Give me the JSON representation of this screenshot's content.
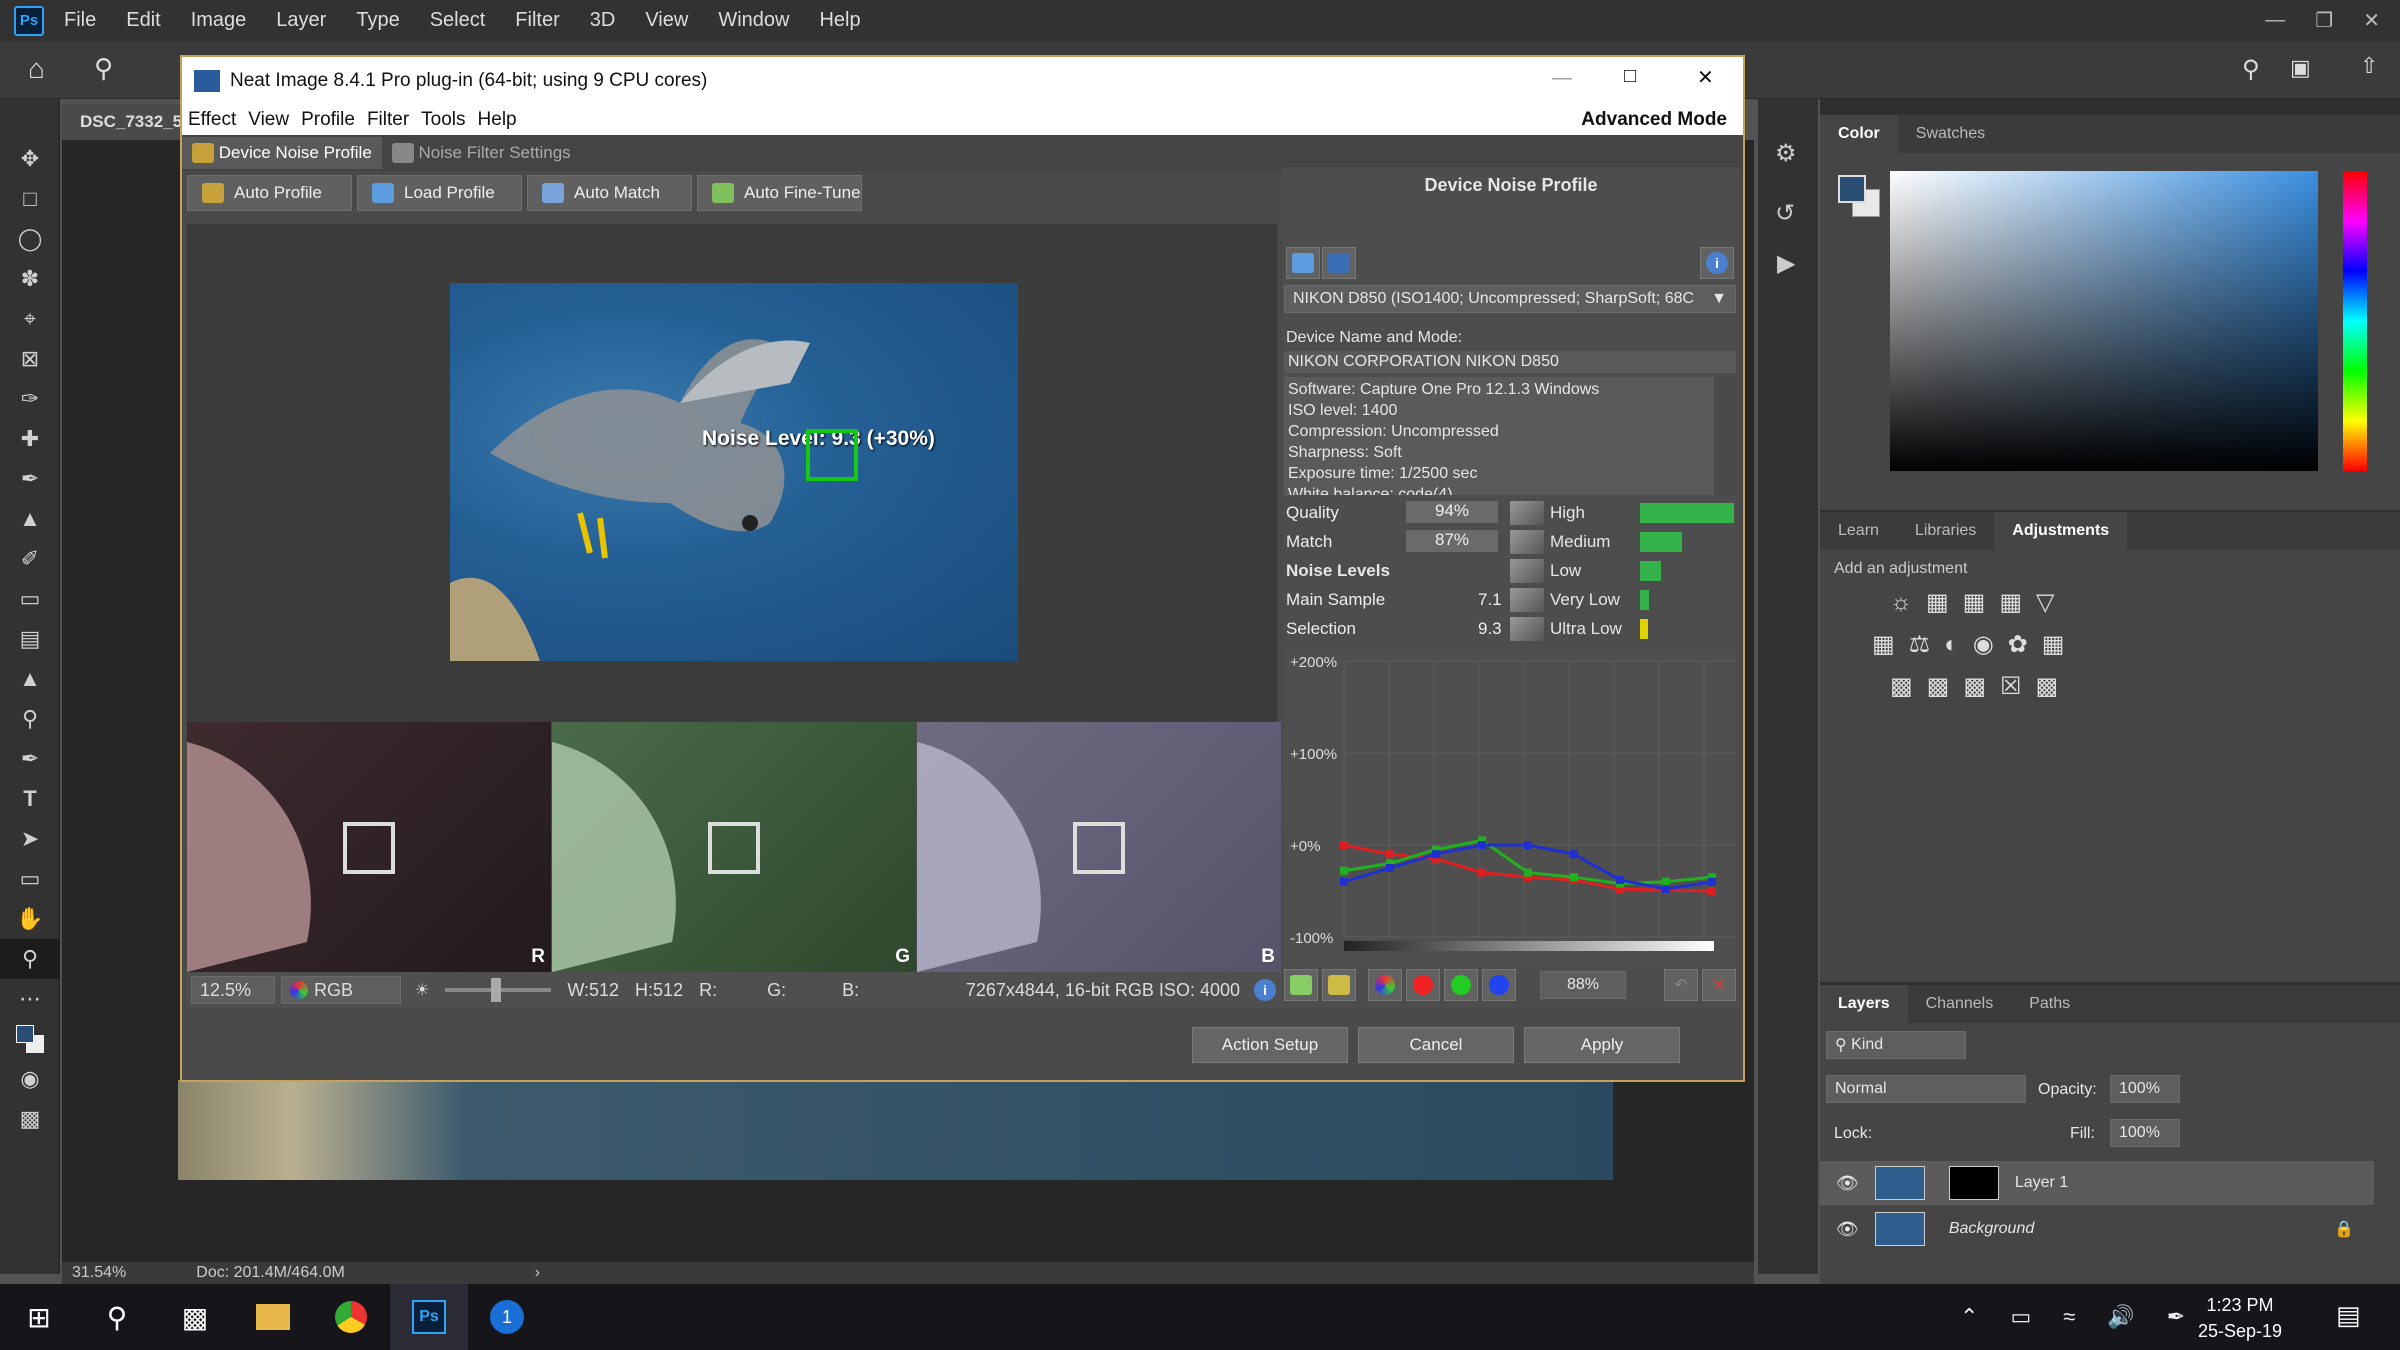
{
  "photoshop": {
    "logo": "Ps",
    "menu": [
      "File",
      "Edit",
      "Image",
      "Layer",
      "Type",
      "Select",
      "Filter",
      "3D",
      "View",
      "Window",
      "Help"
    ],
    "doc_tab": "DSC_7332_5",
    "status_zoom": "31.54%",
    "status_doc": "Doc: 201.4M/464.0M",
    "status_arrow": "›"
  },
  "neat": {
    "title": "Neat Image 8.4.1 Pro plug-in (64-bit; using 9 CPU cores)",
    "menu": [
      "Effect",
      "View",
      "Profile",
      "Filter",
      "Tools",
      "Help"
    ],
    "mode": "Advanced Mode",
    "tabs": [
      "Device Noise Profile",
      "Noise Filter Settings"
    ],
    "buttons": [
      "Auto Profile",
      "Load Profile",
      "Auto Match",
      "Auto Fine-Tune"
    ],
    "noise_label": "Noise Level: 9.3 (+30%)",
    "channels": [
      "R",
      "G",
      "B"
    ],
    "zoom": "12.5%",
    "colorspace": "RGB",
    "w": "W:512",
    "h": "H:512",
    "r": "R:",
    "g": "G:",
    "b": "B:",
    "imginfo": "7267x4844, 16-bit RGB  ISO: 4000",
    "actions": [
      "Action Setup",
      "Cancel",
      "Apply"
    ]
  },
  "dnp": {
    "heading": "Device Noise Profile",
    "profile_select": "NIKON D850 (ISO1400; Uncompressed; SharpSoft; 68C",
    "device_label": "Device Name and Mode:",
    "device_value": "NIKON CORPORATION NIKON D850",
    "details": [
      "Software: Capture One Pro 12.1.3 Windows",
      "ISO level: 1400",
      "Compression: Uncompressed",
      "Sharpness: Soft",
      "Exposure time: 1/2500 sec",
      "White balance: code(4)"
    ],
    "quality_label": "Quality",
    "quality_value": "94%",
    "match_label": "Match",
    "match_value": "87%",
    "levels_heading": "Noise Levels",
    "main_label": "Main Sample",
    "main_value": "7.1",
    "sel_label": "Selection",
    "sel_value": "9.3",
    "freq": [
      "High",
      "Medium",
      "Low",
      "Very Low",
      "Ultra Low"
    ],
    "freq_levels": [
      1.0,
      0.45,
      0.22,
      0.1,
      0.08
    ],
    "freq_colors": [
      "#34b34a",
      "#34b34a",
      "#34b34a",
      "#34b34a",
      "#e0d400"
    ],
    "graph_labels": [
      "+200%",
      "+100%",
      "+0%",
      "-100%"
    ],
    "graph_zoom": "88%"
  },
  "panels": {
    "color_tabs": [
      "Color",
      "Swatches"
    ],
    "adj_tabs": [
      "Learn",
      "Libraries",
      "Adjustments"
    ],
    "adj_hint": "Add an adjustment",
    "layers_tabs": [
      "Layers",
      "Channels",
      "Paths"
    ],
    "kind": "Kind",
    "blend": "Normal",
    "opacity_label": "Opacity:",
    "opacity": "100%",
    "lock_label": "Lock:",
    "fill_label": "Fill:",
    "fill": "100%",
    "layers": [
      "Layer 1",
      "Background"
    ]
  },
  "taskbar": {
    "time": "1:23 PM",
    "date": "25-Sep-19"
  }
}
